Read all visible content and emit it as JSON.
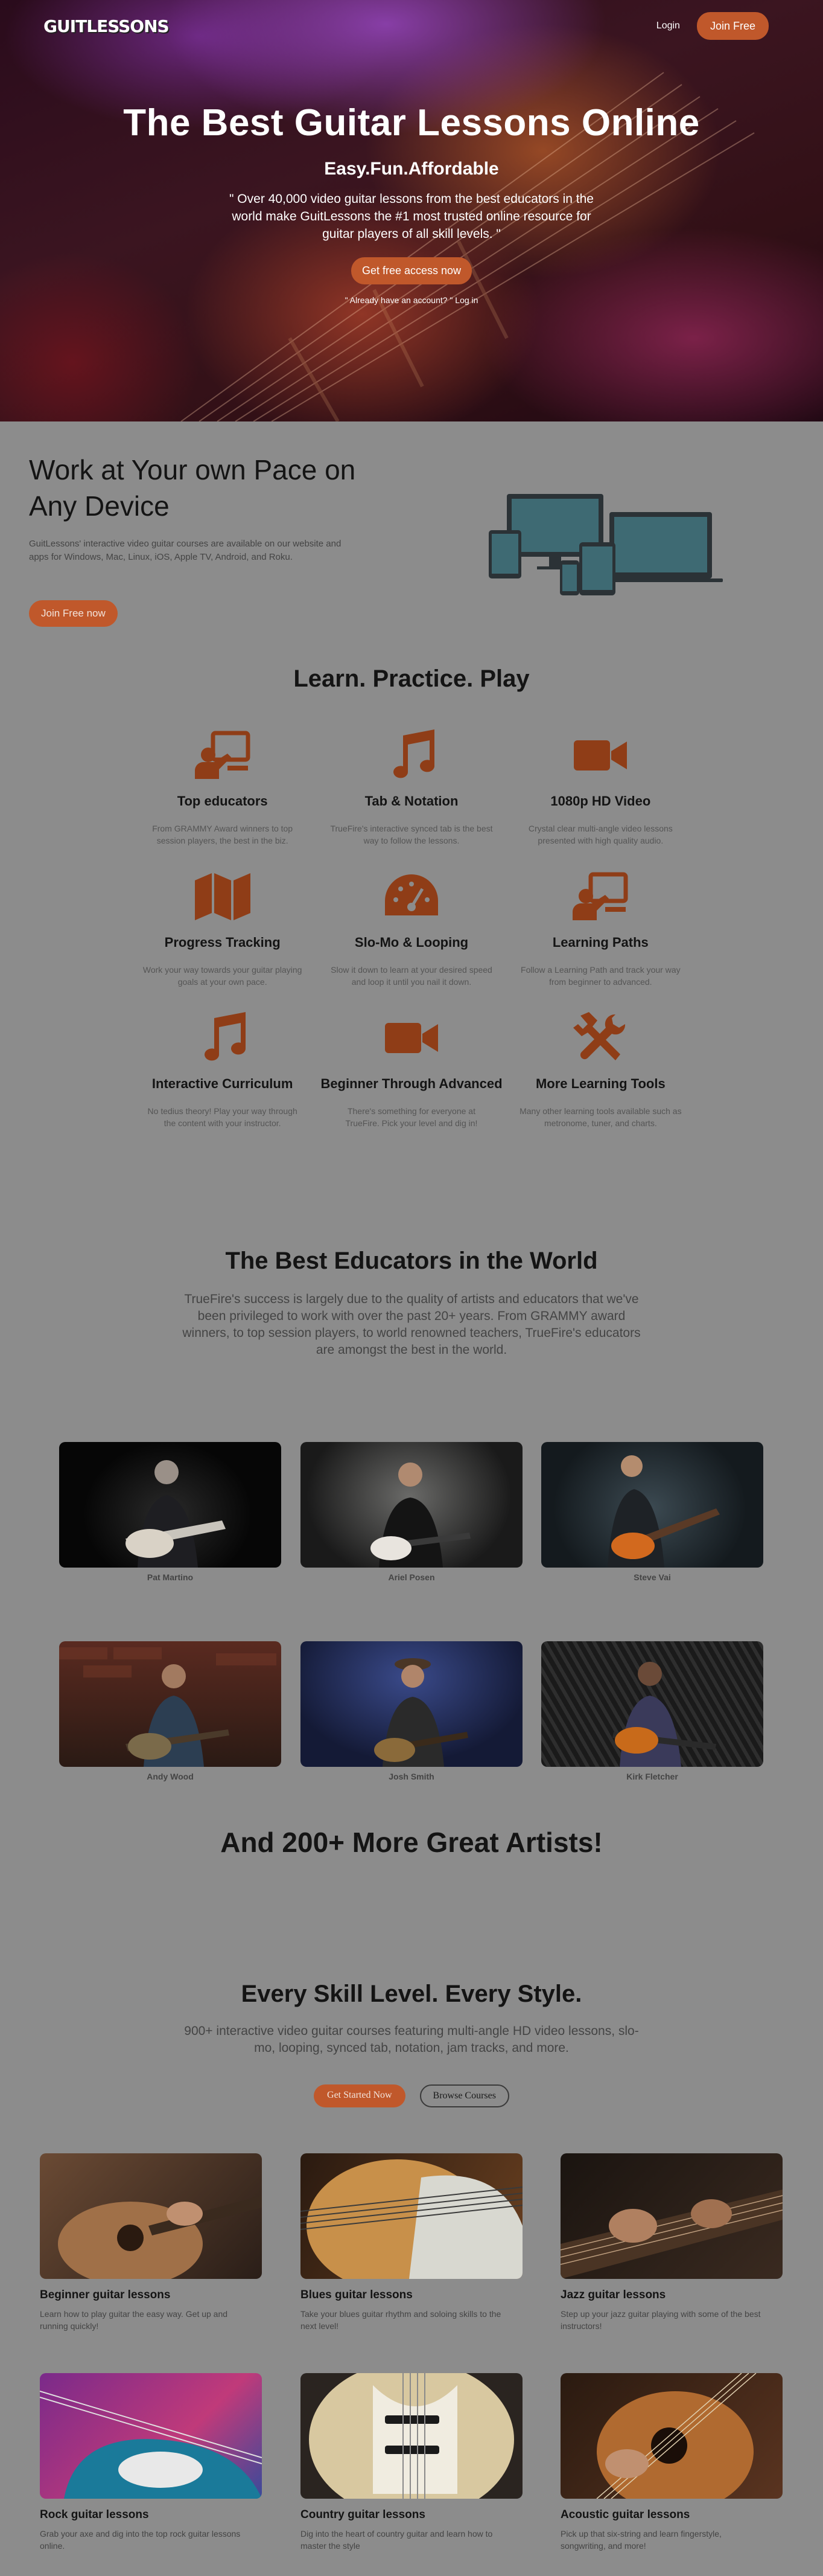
{
  "nav": {
    "logo": "GUITLESSONS",
    "login": "Login",
    "join": "Join Free"
  },
  "hero": {
    "title": "The Best Guitar Lessons Online",
    "subtitle": "Easy.Fun.Affordable",
    "description": "\" Over 40,000 video guitar lessons from the best educators in the world make GuitLessons the #1 most trusted online resource for guitar players of all skill levels. \"",
    "cta": "Get free access now",
    "account": "\" Already have an account? \" Log in"
  },
  "work": {
    "title": "Work at Your own Pace on Any Device",
    "description": "GuitLessons' interactive video guitar courses are available on our website and apps for Windows, Mac, Linux, iOS, Apple TV, Android, and Roku.",
    "cta": "Join Free now"
  },
  "features": {
    "title": "Learn. Practice. Play",
    "items": [
      {
        "icon": "teacher-board-icon",
        "title": "Top educators",
        "desc": "From GRAMMY Award winners to top session players, the best in the biz."
      },
      {
        "icon": "music-note-icon",
        "title": "Tab & Notation",
        "desc": "TrueFire's interactive synced tab is the best way to follow the lessons."
      },
      {
        "icon": "video-camera-icon",
        "title": "1080p HD Video",
        "desc": "Crystal clear multi-angle video lessons presented with high quality audio."
      },
      {
        "icon": "map-icon",
        "title": "Progress Tracking",
        "desc": "Work your way towards your guitar playing goals at your own pace."
      },
      {
        "icon": "speedometer-icon",
        "title": "Slo-Mo & Looping",
        "desc": "Slow it down to learn at your desired speed and loop it until you nail it down."
      },
      {
        "icon": "teacher-board-icon",
        "title": "Learning Paths",
        "desc": "Follow a Learning Path and track your way from beginner to advanced."
      },
      {
        "icon": "music-note-icon",
        "title": "Interactive Curriculum",
        "desc": "No tedius theory! Play your way through the content with your instructor."
      },
      {
        "icon": "video-camera-icon",
        "title": "Beginner Through Advanced",
        "desc": "There's something for everyone at TrueFire. Pick your level and dig in!"
      },
      {
        "icon": "tools-icon",
        "title": "More Learning Tools",
        "desc": "Many other learning tools available such as metronome, tuner, and charts."
      }
    ]
  },
  "educators": {
    "title": "The Best Educators in the World",
    "description": "TrueFire's success is largely due to the quality of artists and educators that we've been privileged to work with over the past 20+ years. From GRAMMY award winners, to top session players, to world renowned teachers, TrueFire's educators are amongst the best in the world.",
    "artists": [
      {
        "name": "Pat Martino"
      },
      {
        "name": "Ariel Posen"
      },
      {
        "name": "Steve Vai"
      },
      {
        "name": "Andy Wood"
      },
      {
        "name": "Josh Smith"
      },
      {
        "name": "Kirk Fletcher"
      }
    ],
    "more": "And 200+ More Great Artists!"
  },
  "skill": {
    "title": "Every Skill Level. Every Style.",
    "description": "900+ interactive video guitar courses featuring multi-angle HD video lessons, slo-mo, looping, synced tab, notation, jam tracks, and more.",
    "start": "Get Started Now",
    "browse": "Browse Courses",
    "courses": [
      {
        "title": "Beginner guitar lessons",
        "desc": "Learn how to play guitar the easy way. Get up and running quickly!"
      },
      {
        "title": "Blues guitar lessons",
        "desc": "Take your blues guitar rhythm and soloing skills to the next level!"
      },
      {
        "title": "Jazz guitar lessons",
        "desc": "Step up your jazz guitar playing with some of the best instructors!"
      },
      {
        "title": "Rock guitar lessons",
        "desc": "Grab your axe and dig into the top rock guitar lessons online."
      },
      {
        "title": "Country guitar lessons",
        "desc": "Dig into the heart of country guitar and learn how to master the style"
      },
      {
        "title": "Acoustic guitar lessons",
        "desc": "Pick up that six-string and learn fingerstyle, songwriting, and more!"
      }
    ]
  },
  "colors": {
    "accent": "#c0582b",
    "page_bg": "#8c8c8c",
    "text": "#141414"
  }
}
